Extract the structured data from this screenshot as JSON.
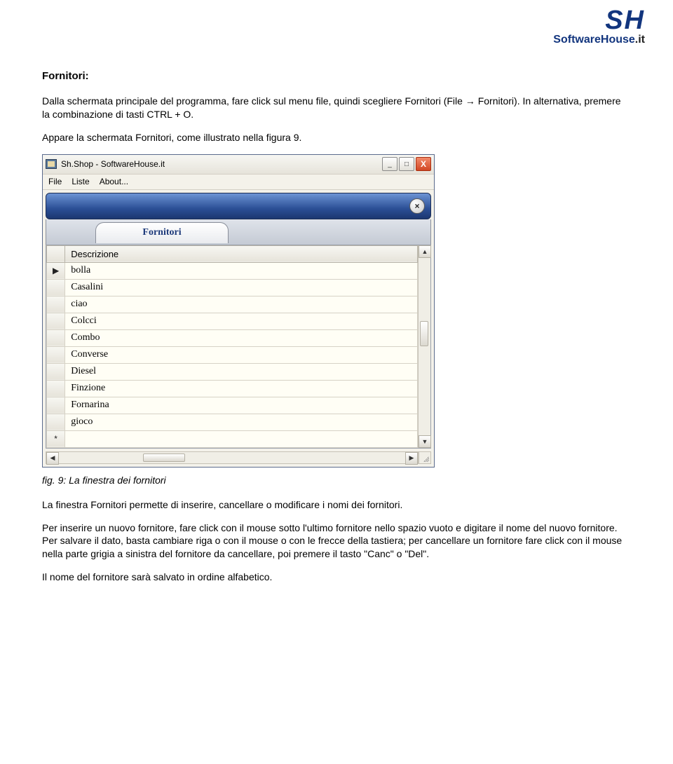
{
  "logo": {
    "top": "SH",
    "sub_left": "Software",
    "sub_mid": "H",
    "sub_right": "ouse",
    "sub_ext": ".it"
  },
  "doc": {
    "heading": "Fornitori:",
    "p1": "Dalla schermata principale del programma, fare click sul menu file, quindi scegliere Fornitori (File → Fornitori). In alternativa, premere la combinazione di tasti CTRL + O.",
    "p2": "Appare la schermata Fornitori, come illustrato nella figura 9.",
    "caption": "fig. 9: La finestra dei fornitori",
    "p3": "La finestra Fornitori permette di inserire, cancellare o modificare i nomi dei fornitori.",
    "p4": "Per inserire un nuovo fornitore, fare click con il mouse sotto l'ultimo fornitore nello spazio vuoto e digitare il nome del nuovo fornitore. Per salvare il dato, basta cambiare riga o con il mouse o con le frecce della tastiera; per cancellare un fornitore fare click con il mouse nella parte grigia a sinistra del fornitore da cancellare, poi premere il tasto \"Canc\" o \"Del\".",
    "p5": "Il nome del fornitore sarà salvato in ordine alfabetico."
  },
  "win": {
    "title": "Sh.Shop - SoftwareHouse.it",
    "menu": {
      "file": "File",
      "liste": "Liste",
      "about": "About..."
    },
    "tab": "Fornitori",
    "column_header": "Descrizione",
    "rows": [
      {
        "marker": "▶",
        "value": "bolla"
      },
      {
        "marker": "",
        "value": "Casalini"
      },
      {
        "marker": "",
        "value": "ciao"
      },
      {
        "marker": "",
        "value": "Colcci"
      },
      {
        "marker": "",
        "value": "Combo"
      },
      {
        "marker": "",
        "value": "Converse"
      },
      {
        "marker": "",
        "value": "Diesel"
      },
      {
        "marker": "",
        "value": "Finzione"
      },
      {
        "marker": "",
        "value": "Fornarina"
      },
      {
        "marker": "",
        "value": "gioco"
      },
      {
        "marker": "*",
        "value": ""
      }
    ],
    "buttons": {
      "minimize": "_",
      "maximize": "□",
      "close": "X",
      "toolbar_close": "×"
    }
  }
}
